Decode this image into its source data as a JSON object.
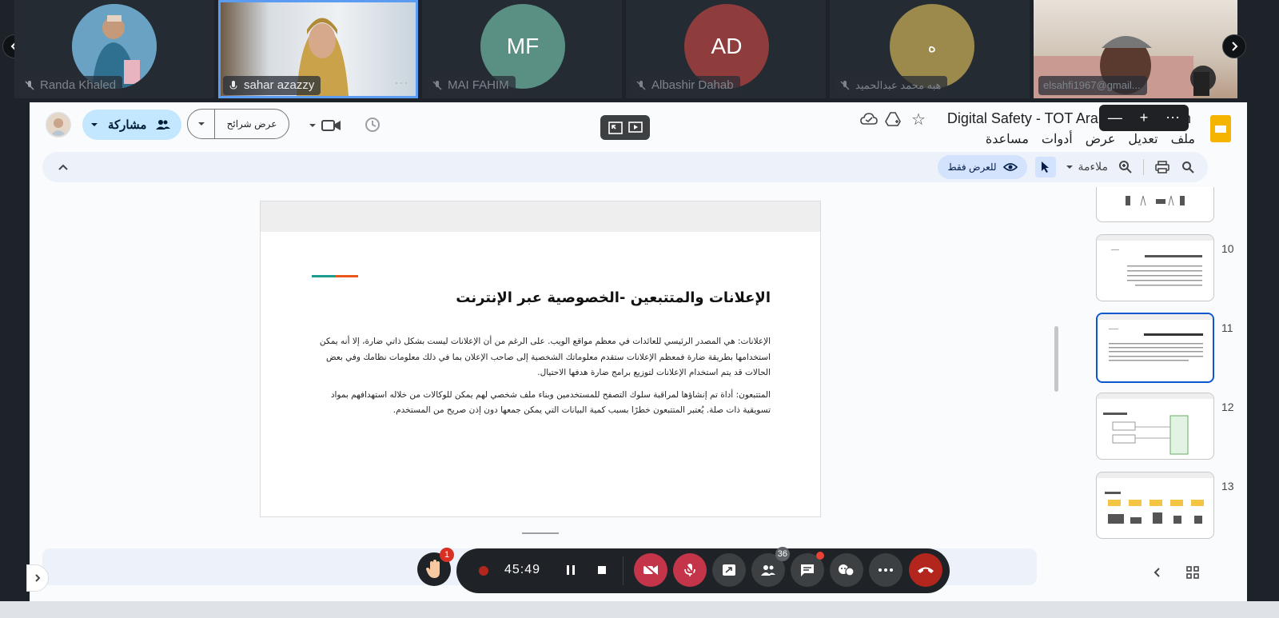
{
  "participants": [
    {
      "name": "Randa Khaled",
      "muted": true
    },
    {
      "name": "sahar azazzy",
      "muted": false
    },
    {
      "name": "MAI FAHIM",
      "initials": "MF",
      "muted": true,
      "color": "#5a8f84"
    },
    {
      "name": "Albashir Dahab",
      "initials": "AD",
      "muted": true,
      "color": "#8e3c3c"
    },
    {
      "name": "هبه محمد عبدالحميد",
      "initials": "ه",
      "muted": true,
      "color": "#9b8a4c"
    },
    {
      "name": "elsahfi1967@gmail...",
      "muted": false
    }
  ],
  "doc": {
    "title": "Digital Safety - TOT Arabic Translation",
    "menu": [
      "ملف",
      "تعديل",
      "عرض",
      "أدوات",
      "مساعدة"
    ]
  },
  "toolbar": {
    "share_label": "مشاركة",
    "slideshow_label": "عرض شرائح",
    "view_only_label": "للعرض فقط",
    "zoom_label": "ملاءمة"
  },
  "slide": {
    "title": "الإعلانات والمتتبعين -الخصوصية عبر الإنترنت",
    "paragraph1": "الإعلانات: هي المصدر الرئيسي للعائدات في معظم مواقع الويب. على الرغم من أن الإعلانات ليست بشكل ذاتي ضارة، إلا أنه يمكن استخدامها بطريقة ضارة فمعظم الإعلانات ستقدم معلوماتك الشخصية إلى صاحب الإعلان بما في ذلك معلومات نظامك وفي بعض الحالات قد يتم استخدام الإعلانات لتوزيع برامج ضارة هدفها الاحتيال.",
    "paragraph2": "المتتبعون: أداة تم إنشاؤها لمراقبة سلوك التصفح للمستخدمين وبناء ملف شخصي لهم يمكن للوكالات من خلاله استهدافهم بمواد تسويقية ذات صلة. يُعتبر المتتبعون خطرًا بسبب كمية البيانات التي يمكن جمعها دون إذن صريح من المستخدم."
  },
  "filmstrip": [
    {
      "number": "",
      "selected": false
    },
    {
      "number": "10",
      "selected": false
    },
    {
      "number": "11",
      "selected": true
    },
    {
      "number": "12",
      "selected": false
    },
    {
      "number": "13",
      "selected": false
    }
  ],
  "meeting": {
    "timer": "45:49",
    "hand_badge": "1",
    "people_badge": "36"
  }
}
